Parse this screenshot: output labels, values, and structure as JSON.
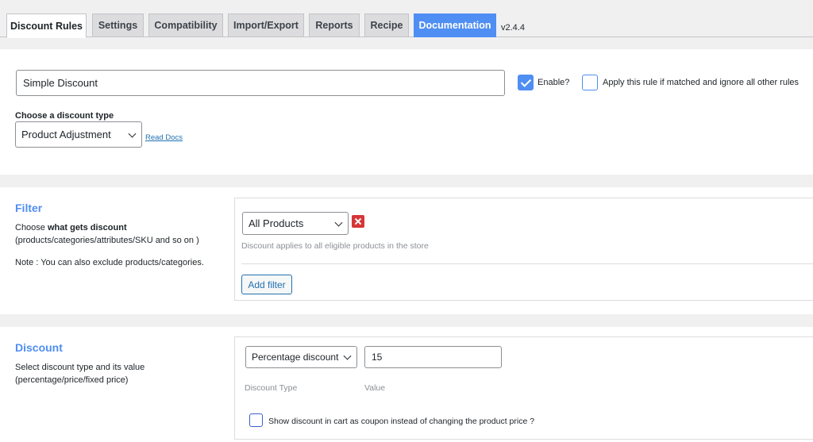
{
  "tabs": [
    {
      "label": "Discount Rules"
    },
    {
      "label": "Settings"
    },
    {
      "label": "Compatibility"
    },
    {
      "label": "Import/Export"
    },
    {
      "label": "Reports"
    },
    {
      "label": "Recipe"
    },
    {
      "label": "Documentation"
    }
  ],
  "version": "v2.4.4",
  "rule": {
    "name_value": "Simple Discount",
    "enable_label": "Enable?",
    "enable_checked": true,
    "exclusive_label": "Apply this rule if matched and ignore all other rules",
    "exclusive_checked": false,
    "discount_type_heading": "Choose a discount type",
    "discount_type_value": "Product Adjustment",
    "read_docs": "Read Docs"
  },
  "filter": {
    "heading": "Filter",
    "desc_prefix": "Choose ",
    "desc_bold": "what gets discount",
    "desc_line2": "(products/categories/attributes/SKU and so on )",
    "note": "Note : You can also exclude products/categories.",
    "select_value": "All Products",
    "help": "Discount applies to all eligible products in the store",
    "add_button": "Add filter"
  },
  "discount": {
    "heading": "Discount",
    "desc_line1": "Select discount type and its value",
    "desc_line2": "(percentage/price/fixed price)",
    "type_value": "Percentage discount",
    "value": "15",
    "type_label": "Discount Type",
    "value_label": "Value",
    "coupon_label": "Show discount in cart as coupon instead of changing the product price ?",
    "coupon_checked": false
  },
  "colors": {
    "accent": "#4f8ef2",
    "link": "#2271b1",
    "danger": "#d63638"
  }
}
